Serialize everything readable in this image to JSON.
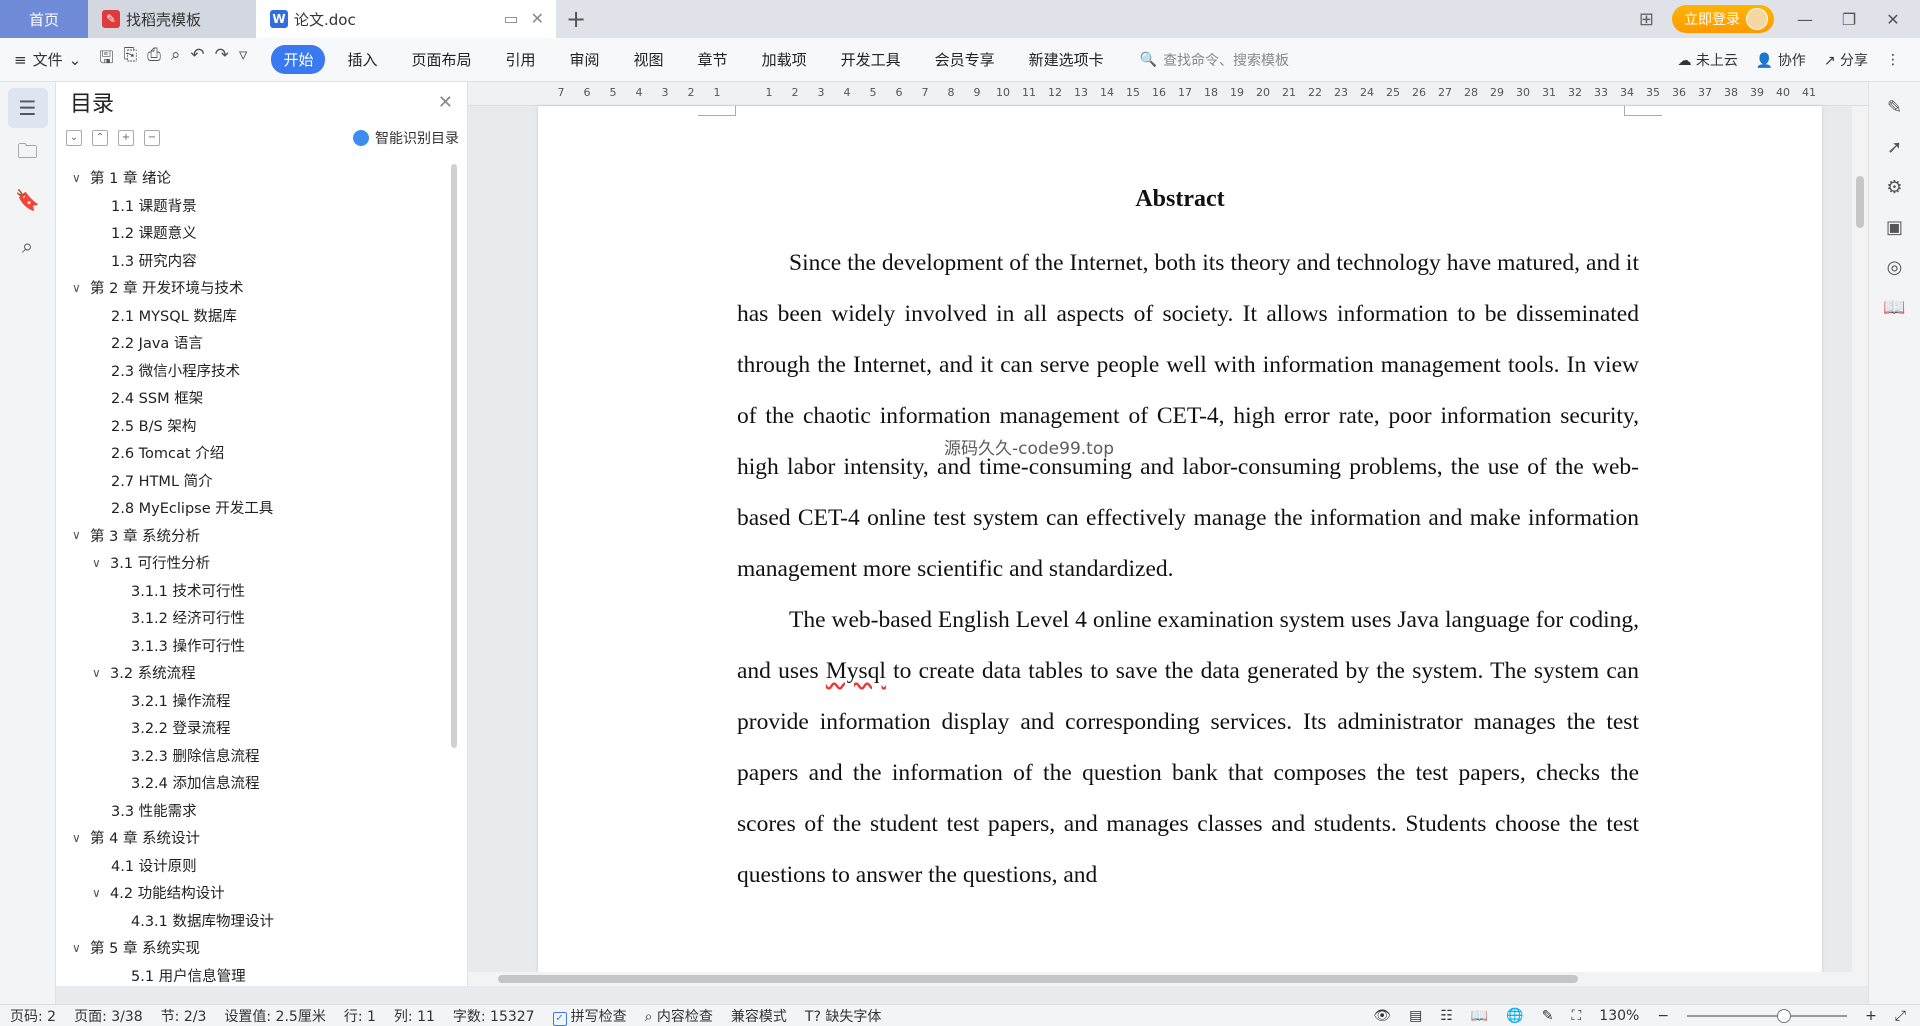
{
  "tabs": {
    "home": "首页",
    "template": "找稻壳模板",
    "doc": "论文.doc",
    "login": "立即登录"
  },
  "ribbon": {
    "file": "文件",
    "tabs": [
      "开始",
      "插入",
      "页面布局",
      "引用",
      "审阅",
      "视图",
      "章节",
      "加载项",
      "开发工具",
      "会员专享",
      "新建选项卡"
    ],
    "search_placeholder": "查找命令、搜索模板",
    "cloud": "未上云",
    "collab": "协作",
    "share": "分享"
  },
  "toc": {
    "title": "目录",
    "smart": "智能识别目录",
    "items": [
      {
        "level": "l1",
        "arrow": "∨",
        "label": "第 1 章  绪论"
      },
      {
        "level": "l2",
        "label": "1.1  课题背景"
      },
      {
        "level": "l2",
        "label": "1.2  课题意义"
      },
      {
        "level": "l2",
        "label": "1.3  研究内容"
      },
      {
        "level": "l1",
        "arrow": "∨",
        "label": "第 2 章  开发环境与技术"
      },
      {
        "level": "l2",
        "label": "2.1  MYSQL 数据库"
      },
      {
        "level": "l2",
        "label": "2.2 Java 语言"
      },
      {
        "level": "l2",
        "label": "2.3  微信小程序技术"
      },
      {
        "level": "l2",
        "label": "2.4 SSM 框架"
      },
      {
        "level": "l2",
        "label": "2.5 B/S 架构"
      },
      {
        "level": "l2",
        "label": "2.6 Tomcat  介绍"
      },
      {
        "level": "l2",
        "label": "2.7 HTML 简介"
      },
      {
        "level": "l2",
        "label": "2.8 MyEclipse 开发工具"
      },
      {
        "level": "l1",
        "arrow": "∨",
        "label": "第 3 章  系统分析"
      },
      {
        "level": "l2c",
        "arrow": "∨",
        "label": "3.1  可行性分析"
      },
      {
        "level": "l3",
        "label": "3.1.1  技术可行性"
      },
      {
        "level": "l3",
        "label": "3.1.2  经济可行性"
      },
      {
        "level": "l3",
        "label": "3.1.3  操作可行性"
      },
      {
        "level": "l2c",
        "arrow": "∨",
        "label": "3.2  系统流程"
      },
      {
        "level": "l3",
        "label": "3.2.1  操作流程"
      },
      {
        "level": "l3",
        "label": "3.2.2  登录流程"
      },
      {
        "level": "l3",
        "label": "3.2.3  删除信息流程"
      },
      {
        "level": "l3",
        "label": "3.2.4  添加信息流程"
      },
      {
        "level": "l2",
        "label": "3.3  性能需求"
      },
      {
        "level": "l1",
        "arrow": "∨",
        "label": "第 4 章  系统设计"
      },
      {
        "level": "l2",
        "label": "4.1  设计原则"
      },
      {
        "level": "l2c",
        "arrow": "∨",
        "label": "4.2  功能结构设计"
      },
      {
        "level": "l3",
        "label": "4.3.1  数据库物理设计"
      },
      {
        "level": "l1",
        "arrow": "∨",
        "label": "第 5 章  系统实现"
      },
      {
        "level": "l3",
        "label": "5.1 用户信息管理"
      }
    ]
  },
  "ruler": [
    "7",
    "6",
    "5",
    "4",
    "3",
    "2",
    "1",
    "",
    "1",
    "2",
    "3",
    "4",
    "5",
    "6",
    "7",
    "8",
    "9",
    "10",
    "11",
    "12",
    "13",
    "14",
    "15",
    "16",
    "17",
    "18",
    "19",
    "20",
    "21",
    "22",
    "23",
    "24",
    "25",
    "26",
    "27",
    "28",
    "29",
    "30",
    "31",
    "32",
    "33",
    "34",
    "35",
    "36",
    "37",
    "38",
    "39",
    "40",
    "41"
  ],
  "document": {
    "title": "Abstract",
    "p1": "Since the development of the Internet, both its theory and technology have matured, and it has been widely involved in all aspects of society. It allows information to be disseminated through the Internet, and it can serve people well with information management tools. In view of the chaotic information management of CET-4, high error rate, poor information security, high labor intensity, and time-consuming and labor-consuming problems, the use of the web-based CET-4 online test system can effectively manage the information and make information management more scientific and standardized.",
    "p2_a": "The web-based English Level 4 online examination system uses Java language for coding, and uses ",
    "p2_mysql": "Mysql",
    "p2_b": " to create data tables to save the data generated by the system. The system can provide information display and corresponding services. Its administrator manages the test papers and the information of the question bank that composes the test papers, checks the scores of the student test papers, and manages classes and students. Students choose the test questions to answer the questions, and",
    "watermark": "源码久久-code99.top"
  },
  "status": {
    "page_code": "页码: 2",
    "page": "页面: 3/38",
    "section": "节: 2/3",
    "setting": "设置值: 2.5厘米",
    "row": "行: 1",
    "col": "列: 11",
    "words": "字数: 15327",
    "spell": "拼写检查",
    "content_check": "内容检查",
    "compat": "兼容模式",
    "missing_font": "缺失字体",
    "zoom": "130%"
  }
}
